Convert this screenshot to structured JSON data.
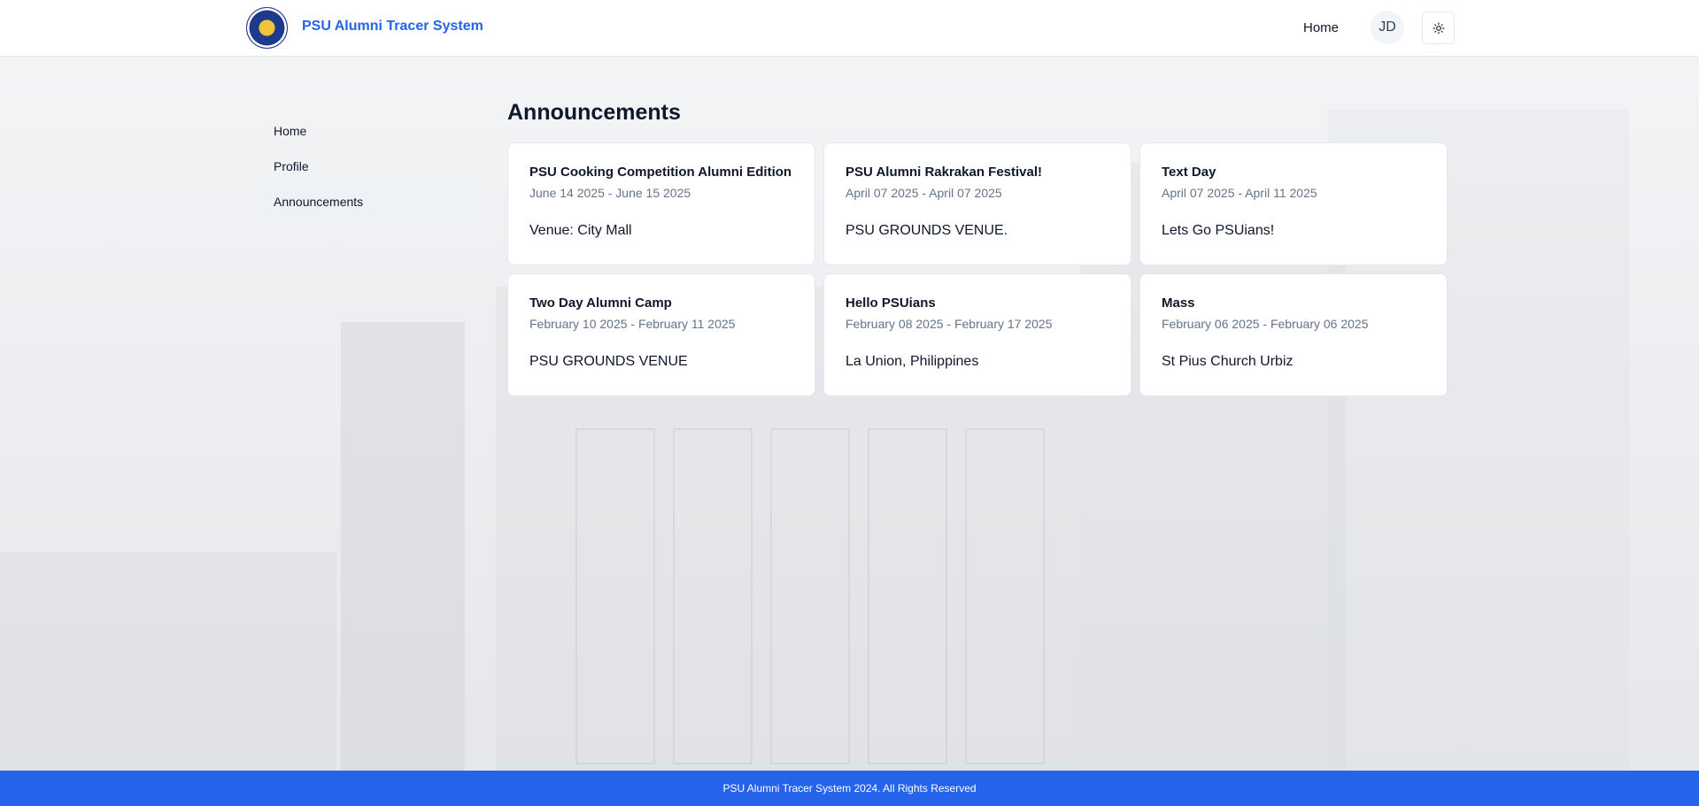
{
  "header": {
    "brand": "PSU Alumni Tracer System",
    "nav_home": "Home",
    "avatar_initials": "JD",
    "theme_icon": "sun-icon"
  },
  "sidebar": {
    "items": [
      {
        "label": "Home",
        "active": false
      },
      {
        "label": "Profile",
        "active": false
      },
      {
        "label": "Announcements",
        "active": true
      }
    ]
  },
  "main": {
    "title": "Announcements",
    "cards": [
      {
        "title": "PSU Cooking Competition Alumni Edition",
        "date": "June 14 2025 - June 15 2025",
        "venue": "Venue: City Mall"
      },
      {
        "title": "PSU Alumni Rakrakan Festival!",
        "date": "April 07 2025 - April 07 2025",
        "venue": "PSU GROUNDS VENUE."
      },
      {
        "title": "Text Day",
        "date": "April 07 2025 - April 11 2025",
        "venue": "Lets Go PSUians!"
      },
      {
        "title": "Two Day Alumni Camp",
        "date": "February 10 2025 - February 11 2025",
        "venue": "PSU GROUNDS VENUE"
      },
      {
        "title": "Hello PSUians",
        "date": "February 08 2025 - February 17 2025",
        "venue": "La Union, Philippines"
      },
      {
        "title": "Mass",
        "date": "February 06 2025 - February 06 2025",
        "venue": "St Pius Church Urbiz"
      }
    ]
  },
  "footer": {
    "text": "PSU Alumni Tracer System 2024. All Rights Reserved"
  },
  "colors": {
    "brand": "#2563eb",
    "footer_bg": "#2563eb",
    "active_bg": "#eef1f5"
  }
}
